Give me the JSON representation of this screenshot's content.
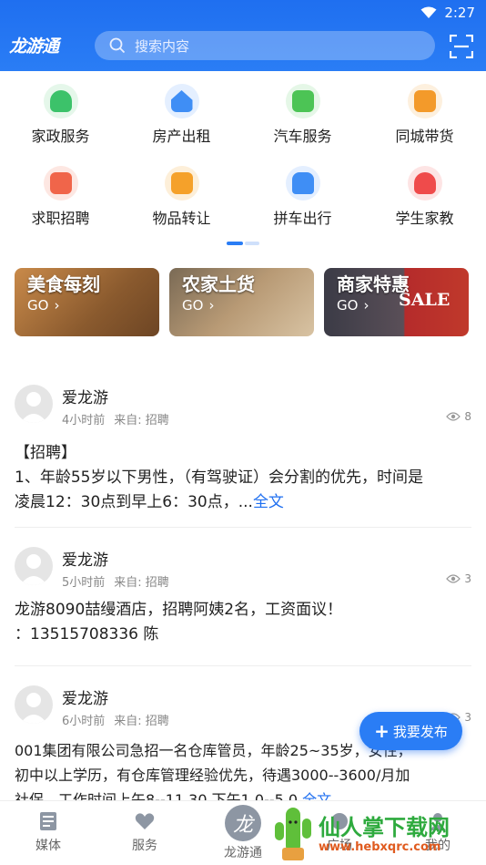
{
  "status_bar": {
    "time": "2:27",
    "wifi_icon": "wifi-icon",
    "battery_icon": "battery-icon"
  },
  "header": {
    "logo": "龙游通",
    "search_placeholder": "搜索内容",
    "scan_icon": "scan-icon"
  },
  "grid": [
    {
      "label": "家政服务",
      "color": "#3cc26a"
    },
    {
      "label": "房产出租",
      "color": "#3f8ef5"
    },
    {
      "label": "汽车服务",
      "color": "#4cc455"
    },
    {
      "label": "同城带货",
      "color": "#f39a2a"
    },
    {
      "label": "求职招聘",
      "color": "#f0654a"
    },
    {
      "label": "物品转让",
      "color": "#f5a12a"
    },
    {
      "label": "拼车出行",
      "color": "#3f8ef5"
    },
    {
      "label": "学生家教",
      "color": "#ef4b4b"
    }
  ],
  "banners": [
    {
      "title": "美食每刻",
      "go": "GO"
    },
    {
      "title": "农家土货",
      "go": "GO"
    },
    {
      "title": "商家特惠",
      "go": "GO"
    }
  ],
  "banner_sale_text": "SALE",
  "posts": [
    {
      "name": "爱龙游",
      "time": "4小时前",
      "from": "来自: 招聘",
      "views": "8",
      "lines": [
        "【招聘】",
        "1、年龄55岁以下男性，（有驾驶证）会分割的优先，时间是"
      ],
      "last_line": "凌晨12：30点到早上6：30点，...",
      "more": "全文"
    },
    {
      "name": "爱龙游",
      "time": "5小时前",
      "from": "来自: 招聘",
      "views": "3",
      "lines": [
        "龙游8090喆缦酒店，招聘阿姨2名，工资面议！",
        "：13515708336 陈"
      ]
    },
    {
      "name": "爱龙游",
      "time": "6小时前",
      "from": "来自: 招聘",
      "views": "3",
      "lines": [
        "001集团有限公司急招一名仓库管员，年龄25~35岁，女性，",
        "初中以上学历，有仓库管理经验优先，待遇3000--3600/月加",
        "社保，工作时间上午8--11.30 下午1.0--5.0"
      ],
      "more": "全文"
    }
  ],
  "fab": {
    "label": "我要发布"
  },
  "tabs": [
    {
      "label": "媒体",
      "icon": "news-icon"
    },
    {
      "label": "服务",
      "icon": "heart-icon"
    },
    {
      "label": "龙游通",
      "icon": "logo-icon"
    },
    {
      "label": "广场",
      "icon": "square-icon"
    },
    {
      "label": "我的",
      "icon": "user-icon"
    }
  ],
  "watermark": {
    "brand": "仙人掌下载网",
    "url": "www.hebxqrc.com"
  },
  "colors": {
    "primary": "#1f6ff0",
    "accent_link": "#1f6ff0"
  }
}
